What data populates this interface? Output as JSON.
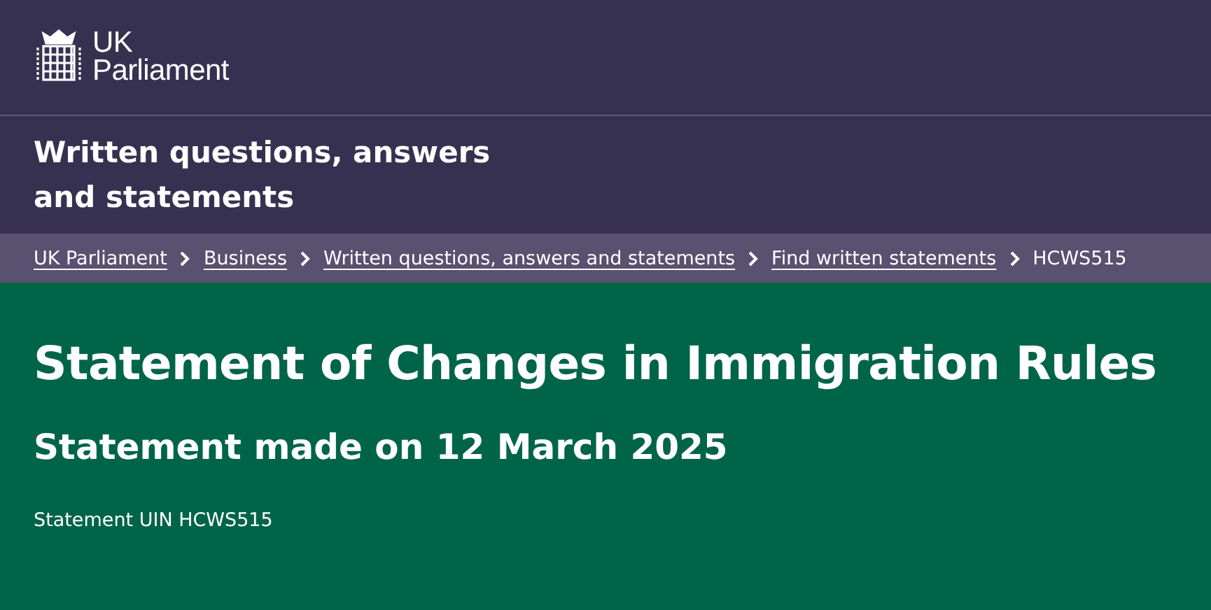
{
  "header": {
    "logo": {
      "line_1": "UK",
      "line_2": "Parliament"
    }
  },
  "section_title": {
    "line_1": "Written questions, answers",
    "line_2": "and statements"
  },
  "breadcrumbs": [
    {
      "label": "UK Parliament",
      "kind": "link"
    },
    {
      "label": "Business",
      "kind": "link"
    },
    {
      "label": "Written questions, answers and statements",
      "kind": "link"
    },
    {
      "label": "Find written statements",
      "kind": "link"
    },
    {
      "label": "HCWS515",
      "kind": "current"
    }
  ],
  "statement": {
    "title": "Statement of Changes in Immigration Rules",
    "subtitle": "Statement made on 12 March 2025",
    "uin": "Statement UIN HCWS515"
  }
}
